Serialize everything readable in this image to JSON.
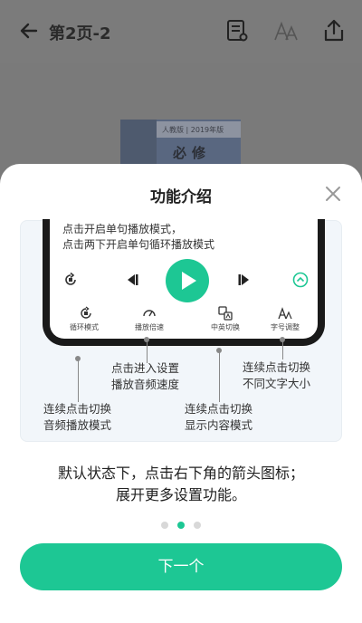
{
  "header": {
    "title": "第2页-2"
  },
  "book": {
    "edition": "人教版 | 2019年版",
    "subject": "必修"
  },
  "sheet": {
    "title": "功能介绍",
    "illustration": {
      "hint_line1": "点击开启单句播放模式，",
      "hint_line2": "点击两下开启单句循环播放模式",
      "labels": {
        "loop": "循环模式",
        "speed": "播放倍速",
        "lang": "中英切换",
        "font": "字号调整"
      },
      "callouts": {
        "speed": [
          "点击进入设置",
          "播放音频速度"
        ],
        "font": [
          "连续点击切换",
          "不同文字大小"
        ],
        "loop": [
          "连续点击切换",
          "音频播放模式"
        ],
        "lang": [
          "连续点击切换",
          "显示内容模式"
        ]
      }
    },
    "description_line1": "默认状态下，点击右下角的箭头图标；",
    "description_line2": "展开更多设置功能。",
    "pager": {
      "total": 3,
      "current": 2
    },
    "next_label": "下一个"
  },
  "colors": {
    "accent": "#1dc794"
  }
}
